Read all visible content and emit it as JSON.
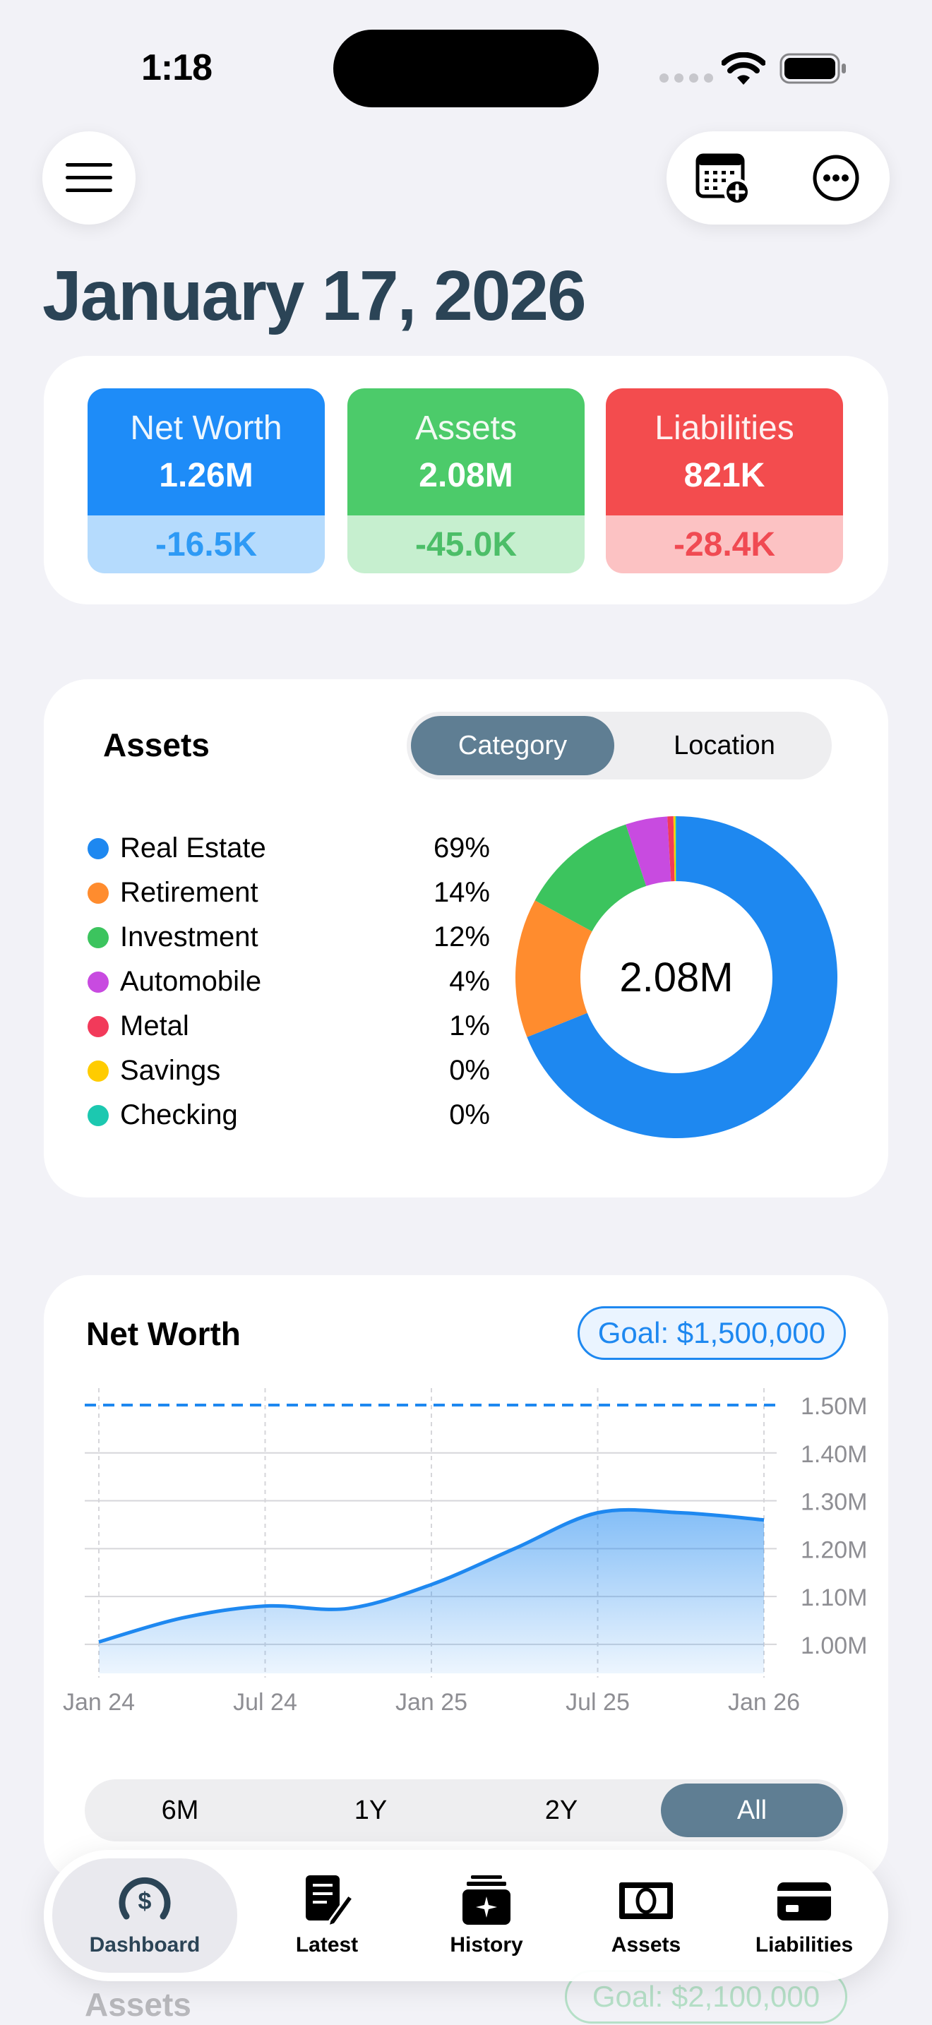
{
  "status_bar": {
    "time": "1:18"
  },
  "header": {
    "date_title": "January 17, 2026"
  },
  "summary": [
    {
      "label": "Net Worth",
      "value": "1.26M",
      "delta": "-16.5K",
      "color": "#1E8CF8",
      "delta_bg": "#B5DBFD",
      "delta_color": "#2E9AF5"
    },
    {
      "label": "Assets",
      "value": "2.08M",
      "delta": "-45.0K",
      "color": "#4CCB6A",
      "delta_bg": "#C6EFCF",
      "delta_color": "#4CBE68"
    },
    {
      "label": "Liabilities",
      "value": "821K",
      "delta": "-28.4K",
      "color": "#F34C4E",
      "delta_bg": "#FCC2C3",
      "delta_color": "#F04A52"
    }
  ],
  "assets_breakdown": {
    "title": "Assets",
    "segments": [
      "Category",
      "Location"
    ],
    "selected_segment": "Category",
    "total": "2.08M",
    "items": [
      {
        "name": "Real Estate",
        "pct": "69%",
        "share": 69.0,
        "color": "#1E88F0"
      },
      {
        "name": "Retirement",
        "pct": "14%",
        "share": 14.0,
        "color": "#FF8C2E"
      },
      {
        "name": "Investment",
        "pct": "12%",
        "share": 12.0,
        "color": "#3CC45E"
      },
      {
        "name": "Automobile",
        "pct": "4%",
        "share": 4.2,
        "color": "#C84BE0"
      },
      {
        "name": "Metal",
        "pct": "1%",
        "share": 0.6,
        "color": "#F23A5A"
      },
      {
        "name": "Savings",
        "pct": "0%",
        "share": 0.2,
        "color": "#FFCC00"
      },
      {
        "name": "Checking",
        "pct": "0%",
        "share": 0.1,
        "color": "#1CC8B0"
      }
    ]
  },
  "net_worth": {
    "title": "Net Worth",
    "goal_label": "Goal: $1,500,000",
    "range_options": [
      "6M",
      "1Y",
      "2Y",
      "All"
    ],
    "selected_range": "All"
  },
  "chart_data": {
    "type": "area",
    "title": "Net Worth",
    "x": [
      "2024-01",
      "2024-04",
      "2024-07",
      "2024-10",
      "2025-01",
      "2025-04",
      "2025-07",
      "2025-10",
      "2026-01"
    ],
    "x_tick_labels": [
      "Jan 24",
      "Jul 24",
      "Jan 25",
      "Jul 25",
      "Jan 26"
    ],
    "y_tick_labels": [
      "1.50M",
      "1.40M",
      "1.30M",
      "1.20M",
      "1.10M",
      "1.00M"
    ],
    "y_ticks": [
      1500000,
      1400000,
      1300000,
      1200000,
      1100000,
      1000000
    ],
    "series": [
      {
        "values": [
          1005000,
          1055000,
          1080000,
          1075000,
          1125000,
          1200000,
          1275000,
          1275000,
          1260000
        ]
      }
    ],
    "goal": 1500000,
    "ylim": [
      960000,
      1500000
    ],
    "grid": true,
    "color": "#1E88F0"
  },
  "next_card_peek": {
    "title": "Assets",
    "goal_label": "Goal: $2,100,000"
  },
  "tab_bar": {
    "selected": "Dashboard",
    "tabs": [
      {
        "label": "Dashboard",
        "icon": "dashboard-gauge-icon"
      },
      {
        "label": "Latest",
        "icon": "document-edit-icon"
      },
      {
        "label": "History",
        "icon": "history-stack-icon"
      },
      {
        "label": "Assets",
        "icon": "banknote-icon"
      },
      {
        "label": "Liabilities",
        "icon": "credit-card-icon"
      }
    ]
  }
}
